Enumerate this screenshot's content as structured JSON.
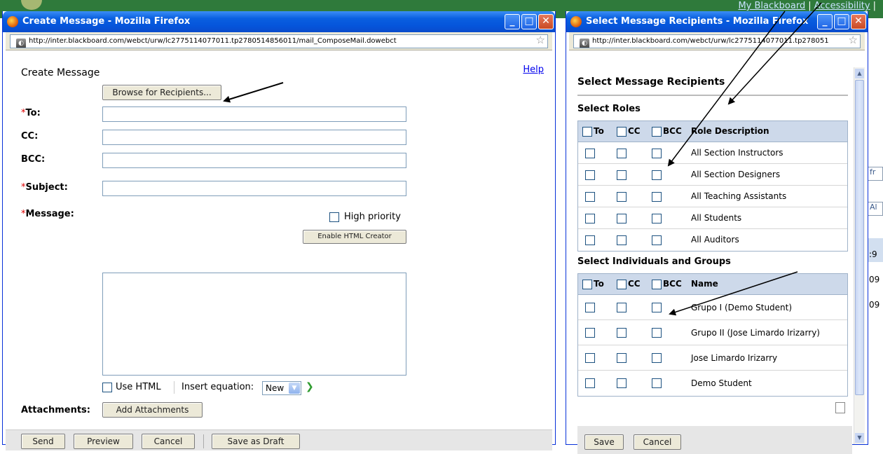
{
  "background": {
    "top_links": [
      "My Blackboard",
      "Accessibility",
      "|"
    ],
    "right_fragments": [
      "fr",
      "Al",
      ":9",
      "09",
      "09"
    ]
  },
  "create_window": {
    "title": "Create Message - Mozilla Firefox",
    "url": "http://inter.blackboard.com/webct/urw/lc2775114077011.tp2780514856011/mail_ComposeMail.dowebct",
    "heading": "Create Message",
    "help": "Help",
    "browse_button": "Browse for Recipients...",
    "fields": {
      "to_label": "To:",
      "cc_label": "CC:",
      "bcc_label": "BCC:",
      "subject_label": "Subject:",
      "message_label": "Message:",
      "required_mark": "*"
    },
    "high_priority": "High priority",
    "enable_html_creator": "Enable HTML Creator",
    "use_html": "Use HTML",
    "insert_equation": "Insert equation:",
    "equation_option": "New",
    "attachments_label": "Attachments:",
    "add_attachments": "Add Attachments",
    "footer": {
      "send": "Send",
      "preview": "Preview",
      "cancel": "Cancel",
      "save_draft": "Save as Draft"
    }
  },
  "recipients_window": {
    "title": "Select Message Recipients - Mozilla Firefox",
    "url": "http://inter.blackboard.com/webct/urw/lc2775114077011.tp278051",
    "heading": "Select Message Recipients",
    "roles_section": "Select Roles",
    "col_to": "To",
    "col_cc": "CC",
    "col_bcc": "BCC",
    "col_role": "Role Description",
    "roles": [
      "All Section Instructors",
      "All Section Designers",
      "All Teaching Assistants",
      "All Students",
      "All Auditors"
    ],
    "individuals_section": "Select Individuals and Groups",
    "col_name": "Name",
    "individuals": [
      "Grupo I (Demo Student)",
      "Grupo II (Jose Limardo Irizarry)",
      "Jose Limardo Irizarry",
      "Demo Student"
    ],
    "save": "Save",
    "cancel": "Cancel"
  }
}
